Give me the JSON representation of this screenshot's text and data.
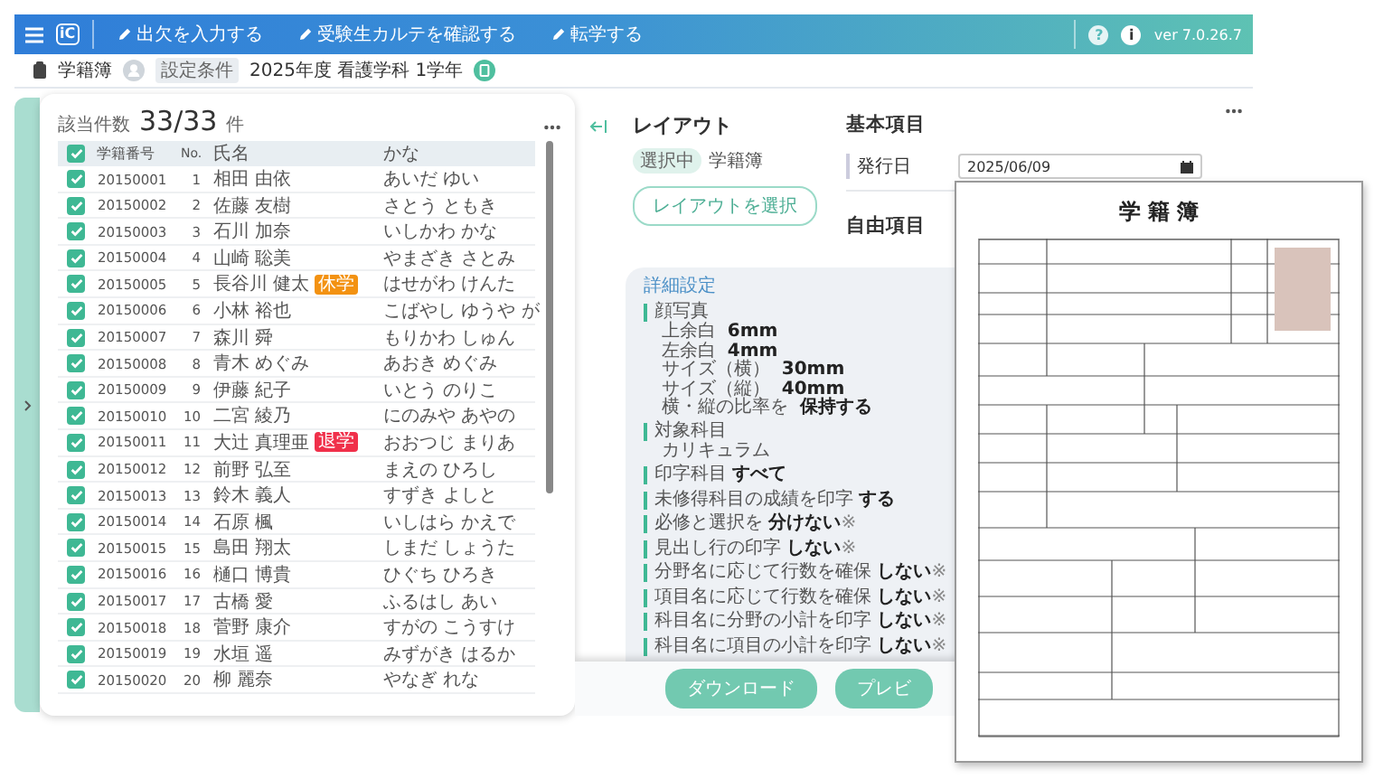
{
  "topbar": {
    "logo": "iC",
    "menu": [
      {
        "label": "出欠を入力する"
      },
      {
        "label": "受験生カルテを確認する"
      },
      {
        "label": "転学する"
      }
    ],
    "help_icon": "?",
    "info_icon": "i",
    "version": "ver 7.0.26.7"
  },
  "subbar": {
    "title": "学籍簿",
    "condition_tag": "設定条件",
    "condition": "2025年度 看護学科 1学年"
  },
  "student_list": {
    "count_label": "該当件数",
    "count": "33/33",
    "count_unit": "件",
    "all_checked": true,
    "columns": [
      "学籍番号",
      "No.",
      "氏名",
      "かな"
    ],
    "rows": [
      {
        "id": "20150001",
        "no": "1",
        "name": "相田 由依",
        "kana": "あいだ ゆい",
        "checked": true
      },
      {
        "id": "20150002",
        "no": "2",
        "name": "佐藤 友樹",
        "kana": "さとう ともき",
        "checked": true
      },
      {
        "id": "20150003",
        "no": "3",
        "name": "石川 加奈",
        "kana": "いしかわ かな",
        "checked": true
      },
      {
        "id": "20150004",
        "no": "4",
        "name": "山崎 聡美",
        "kana": "やまざき さとみ",
        "checked": true
      },
      {
        "id": "20150005",
        "no": "5",
        "name": "長谷川 健太",
        "kana": "はせがわ けんた",
        "checked": true,
        "tag": {
          "label": "休学",
          "color": "#f39212"
        }
      },
      {
        "id": "20150006",
        "no": "6",
        "name": "小林 裕也",
        "kana": "こばやし ゆうや が",
        "checked": true
      },
      {
        "id": "20150007",
        "no": "7",
        "name": "森川 舜",
        "kana": "もりかわ しゅん",
        "checked": true
      },
      {
        "id": "20150008",
        "no": "8",
        "name": "青木 めぐみ",
        "kana": "あおき めぐみ",
        "checked": true
      },
      {
        "id": "20150009",
        "no": "9",
        "name": "伊藤 紀子",
        "kana": "いとう のりこ",
        "checked": true
      },
      {
        "id": "20150010",
        "no": "10",
        "name": "二宮 綾乃",
        "kana": "にのみや あやの",
        "checked": true
      },
      {
        "id": "20150011",
        "no": "11",
        "name": "大辻 真理亜",
        "kana": "おおつじ まりあ",
        "checked": true,
        "tag": {
          "label": "退学",
          "color": "#f0304a"
        }
      },
      {
        "id": "20150012",
        "no": "12",
        "name": "前野 弘至",
        "kana": "まえの ひろし",
        "checked": true
      },
      {
        "id": "20150013",
        "no": "13",
        "name": "鈴木 義人",
        "kana": "すずき よしと",
        "checked": true
      },
      {
        "id": "20150014",
        "no": "14",
        "name": "石原 楓",
        "kana": "いしはら かえで",
        "checked": true
      },
      {
        "id": "20150015",
        "no": "15",
        "name": "島田 翔太",
        "kana": "しまだ しょうた",
        "checked": true
      },
      {
        "id": "20150016",
        "no": "16",
        "name": "樋口 博貴",
        "kana": "ひぐち ひろき",
        "checked": true
      },
      {
        "id": "20150017",
        "no": "17",
        "name": "古橋 愛",
        "kana": "ふるはし あい",
        "checked": true
      },
      {
        "id": "20150018",
        "no": "18",
        "name": "菅野 康介",
        "kana": "すがの こうすけ",
        "checked": true
      },
      {
        "id": "20150019",
        "no": "19",
        "name": "水垣 遥",
        "kana": "みずがき はるか",
        "checked": true
      },
      {
        "id": "20150020",
        "no": "20",
        "name": "柳 麗奈",
        "kana": "やなぎ れな",
        "checked": true
      }
    ]
  },
  "layout": {
    "title": "レイアウト",
    "selected_tag": "選択中",
    "selected_name": "学籍簿",
    "select_button": "レイアウトを選択"
  },
  "basic_items": {
    "title": "基本項目",
    "fields": [
      {
        "label": "発行日",
        "value": "2025/06/09"
      }
    ]
  },
  "free_items": {
    "title": "自由項目"
  },
  "detail_settings": {
    "title": "詳細設定",
    "sections": [
      {
        "kind": "group",
        "label": "顔写真",
        "items": [
          {
            "label": "上余白",
            "value": "6mm"
          },
          {
            "label": "左余白",
            "value": "4mm"
          },
          {
            "label": "サイズ（横）",
            "value": "30mm"
          },
          {
            "label": "サイズ（縦）",
            "value": "40mm"
          },
          {
            "label": "横・縦の比率を",
            "value": "保持する"
          }
        ]
      },
      {
        "kind": "group",
        "label": "対象科目",
        "items": [
          {
            "label": "カリキュラム"
          }
        ]
      },
      {
        "kind": "setting",
        "label": "印字科目",
        "value": "すべて"
      },
      {
        "kind": "setting",
        "label": "未修得科目の成績を印字",
        "value": "する"
      },
      {
        "kind": "setting",
        "label": "必修と選択を",
        "value": "分けない",
        "note": "※"
      },
      {
        "kind": "setting",
        "label": "見出し行の印字",
        "value": "しない",
        "note": "※"
      },
      {
        "kind": "setting",
        "label": "分野名に応じて行数を確保",
        "value": "しない",
        "note": "※"
      },
      {
        "kind": "setting",
        "label": "項目名に応じて行数を確保",
        "value": "しない",
        "note": "※"
      },
      {
        "kind": "setting",
        "label": "科目名に分野の小計を印字",
        "value": "しない",
        "note": "※"
      },
      {
        "kind": "setting",
        "label": "科目名に項目の小計を印字",
        "value": "しない",
        "note": "※"
      }
    ]
  },
  "actions": [
    {
      "label": "ダウンロード"
    },
    {
      "label": "プレビ"
    }
  ],
  "preview": {
    "title": "学 籍 簿"
  }
}
